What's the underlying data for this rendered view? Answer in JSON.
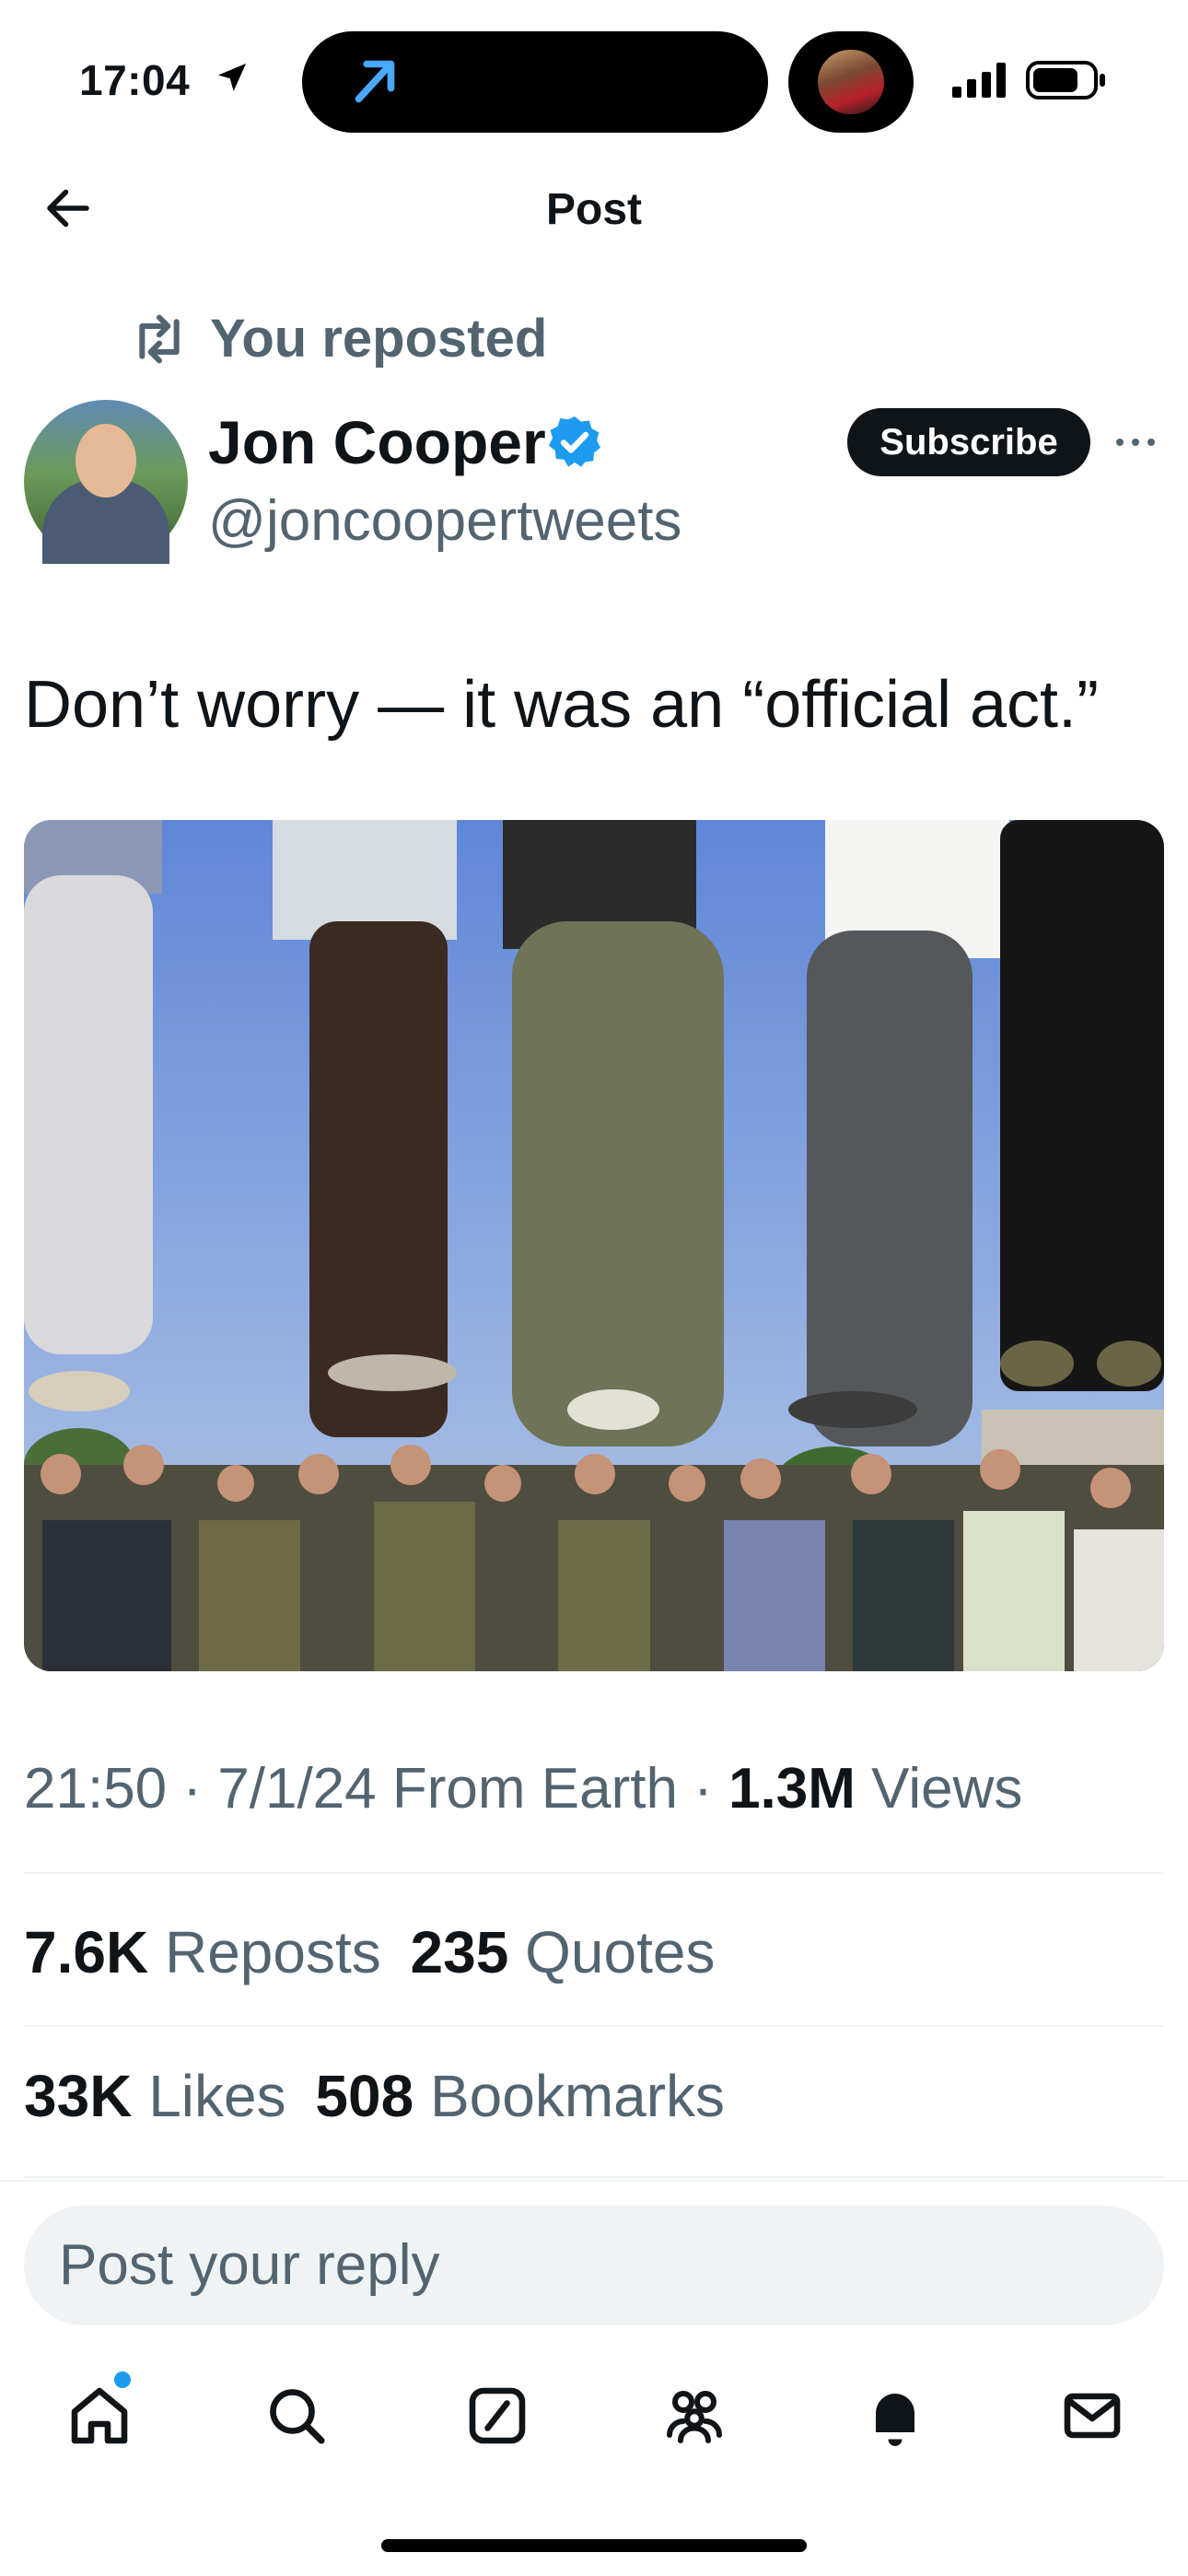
{
  "status_bar": {
    "time": "17:04"
  },
  "header": {
    "title": "Post"
  },
  "repost": {
    "label": "You reposted"
  },
  "author": {
    "name": "Jon Cooper",
    "handle": "@joncoopertweets",
    "verified": true,
    "subscribe_label": "Subscribe"
  },
  "post": {
    "text": "Don’t worry — it was an “official act.”",
    "media_description_icon": "photo",
    "time": "21:50",
    "date": "7/1/24",
    "source": "From Earth",
    "views_count": "1.3M",
    "views_label": "Views"
  },
  "stats": {
    "reposts_count": "7.6K",
    "reposts_label": "Reposts",
    "quotes_count": "235",
    "quotes_label": "Quotes",
    "likes_count": "33K",
    "likes_label": "Likes",
    "bookmarks_count": "508",
    "bookmarks_label": "Bookmarks"
  },
  "reply": {
    "placeholder": "Post your reply"
  },
  "tabs": [
    {
      "icon": "home-icon"
    },
    {
      "icon": "search-icon"
    },
    {
      "icon": "grok-icon"
    },
    {
      "icon": "communities-icon"
    },
    {
      "icon": "bell-icon"
    },
    {
      "icon": "mail-icon"
    }
  ],
  "colors": {
    "accent": "#1d9bf0",
    "verified": "#1d9bf0",
    "secondary_text": "#536471"
  }
}
